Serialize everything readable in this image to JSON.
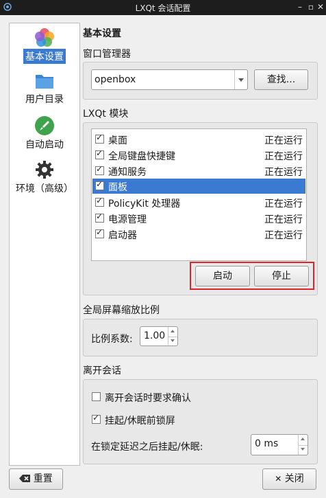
{
  "window": {
    "title": "LXQt 会话配置"
  },
  "sidebar": {
    "items": [
      {
        "label": "基本设置",
        "icon": "palette-flower-icon",
        "selected": true
      },
      {
        "label": "用户目录",
        "icon": "folder-icon"
      },
      {
        "label": "自动启动",
        "icon": "rocket-icon"
      },
      {
        "label": "环境（高级）",
        "icon": "gear-icon"
      }
    ]
  },
  "main": {
    "page_title": "基本设置",
    "wm": {
      "title": "窗口管理器",
      "value": "openbox",
      "search_label": "查找..."
    },
    "modules": {
      "title": "LXQt 模块",
      "rows": [
        {
          "name": "桌面",
          "status": "正在运行",
          "checked": true
        },
        {
          "name": "全局键盘快捷键",
          "status": "正在运行",
          "checked": true
        },
        {
          "name": "通知服务",
          "status": "正在运行",
          "checked": true
        },
        {
          "name": "面板",
          "status": "",
          "checked": true,
          "selected": true
        },
        {
          "name": "PolicyKit 处理器",
          "status": "正在运行",
          "checked": true
        },
        {
          "name": "电源管理",
          "status": "正在运行",
          "checked": true
        },
        {
          "name": "启动器",
          "status": "正在运行",
          "checked": true
        }
      ],
      "start_label": "启动",
      "stop_label": "停止"
    },
    "scale": {
      "title": "全局屏幕缩放比例",
      "label": "比例系数:",
      "value": "1.00"
    },
    "leave": {
      "title": "离开会话",
      "confirm_label": "离开会话时要求确认",
      "confirm_checked": false,
      "lock_label": "挂起/休眠前锁屏",
      "lock_checked": true,
      "delay_label": "在锁定延迟之后挂起/休眠:",
      "delay_value": "0 ms"
    }
  },
  "footer": {
    "reset_label": "重置",
    "close_label": "关闭"
  }
}
